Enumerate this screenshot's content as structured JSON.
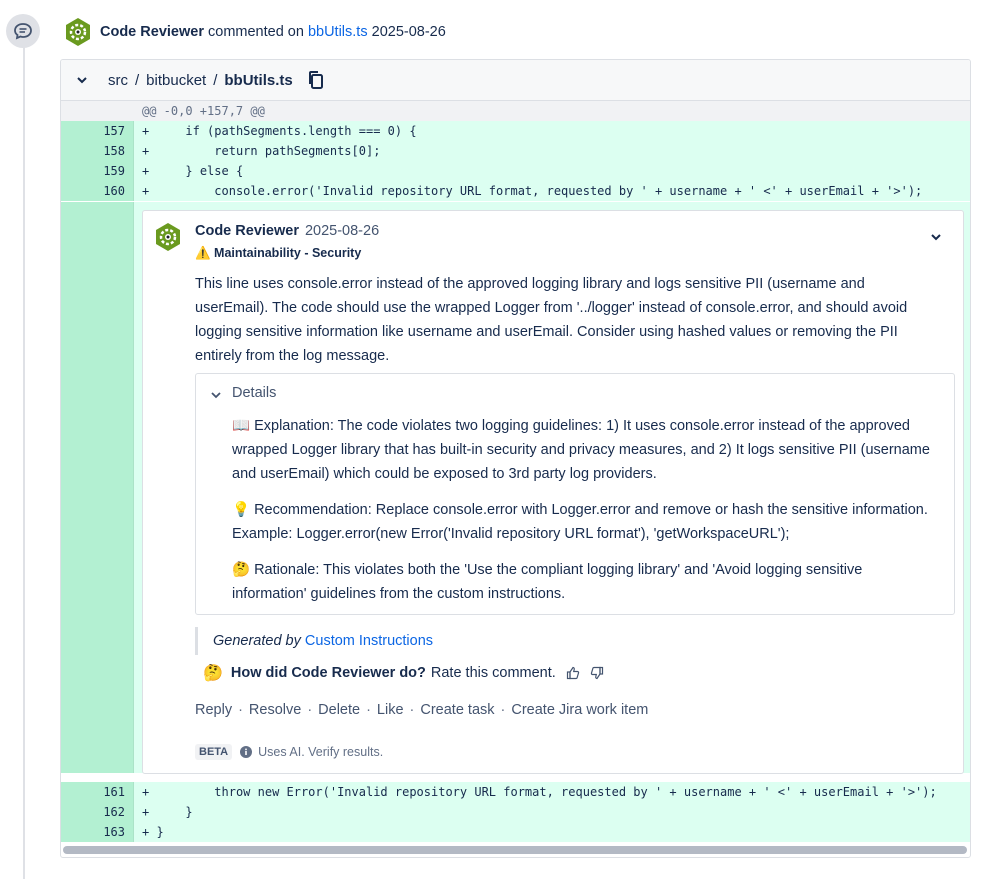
{
  "header": {
    "author": "Code Reviewer",
    "action": "commented on",
    "file_link": "bbUtils.ts",
    "date": "2025-08-26"
  },
  "file": {
    "path": [
      "src",
      "bitbucket",
      "bbUtils.ts"
    ],
    "hunk": "@@ -0,0 +157,7 @@"
  },
  "code_before": [
    {
      "line": "157",
      "marker": "+"
    },
    {
      "line": "158",
      "marker": "+"
    },
    {
      "line": "159",
      "marker": "+"
    },
    {
      "line": "160",
      "marker": "+"
    }
  ],
  "code_after": [
    {
      "line": "161",
      "marker": "+"
    },
    {
      "line": "162",
      "marker": "+"
    },
    {
      "line": "163",
      "marker": "+"
    }
  ],
  "code_text": {
    "l157": "    if (pathSegments.length === 0) {",
    "l158": "        return pathSegments[0];",
    "l159": "    } else {",
    "l160": "        console.error('Invalid repository URL format, requested by ' + username + ' <' + userEmail + '>');",
    "l161": "        throw new Error('Invalid repository URL format, requested by ' + username + ' <' + userEmail + '>');",
    "l162": "    }",
    "l163": "}"
  },
  "comment": {
    "author": "Code Reviewer",
    "date": "2025-08-26",
    "tag": "⚠️ Maintainability - Security",
    "body": "This line uses console.error instead of the approved logging library and logs sensitive PII (username and userEmail). The code should use the wrapped Logger from '../logger' instead of console.error, and should avoid logging sensitive information like username and userEmail. Consider using hashed values or removing the PII entirely from the log message.",
    "details_title": "Details",
    "explanation": "📖 Explanation: The code violates two logging guidelines: 1) It uses console.error instead of the approved wrapped Logger library that has built-in security and privacy measures, and 2) It logs sensitive PII (username and userEmail) which could be exposed to 3rd party log providers.",
    "recommendation": "💡 Recommendation: Replace console.error with Logger.error and remove or hash the sensitive information. Example: Logger.error(new Error('Invalid repository URL format'), 'getWorkspaceURL');",
    "rationale": "🤔 Rationale: This violates both the 'Use the compliant logging library' and 'Avoid logging sensitive information' guidelines from the custom instructions.",
    "generated_prefix": "Generated by",
    "generated_link": "Custom Instructions",
    "rate_emoji": "🤔",
    "rate_question": "How did Code Reviewer do?",
    "rate_prompt": "Rate this comment.",
    "actions": [
      "Reply",
      "Resolve",
      "Delete",
      "Like",
      "Create task",
      "Create Jira work item"
    ],
    "beta_label": "BETA",
    "beta_text": "Uses AI. Verify results."
  },
  "colors": {
    "added_gutter": "#b3f0d2",
    "added_bg": "#dcfff1",
    "link": "#0c66e4",
    "avatar": "#6a9a1f"
  },
  "icons": [
    "comment-icon",
    "avatar-icon",
    "chevron-down-icon",
    "copy-icon",
    "info-icon",
    "thumbs-up-icon",
    "thumbs-down-icon"
  ]
}
